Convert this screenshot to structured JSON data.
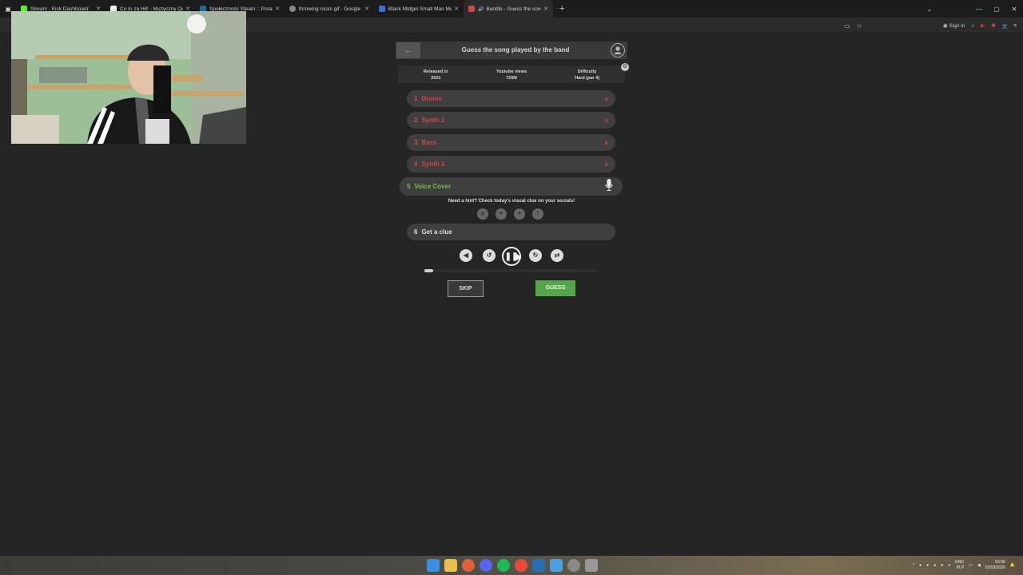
{
  "browser": {
    "tabs": [
      {
        "title": "Stream - Kick Dashboard",
        "color": "#53fc18"
      },
      {
        "title": "Co to za Hit! - Muzyczny Quiz Hip-H",
        "color": "#ffffff"
      },
      {
        "title": "Społeczność Steam :: Poradnik",
        "color": "#1b6aa5"
      },
      {
        "title": "throwing rocks gif - Google Search",
        "color": "#888888"
      },
      {
        "title": "Black Midget Small Man Meme",
        "color": "#3b6fd6"
      },
      {
        "title": "Bandle - Guess the song, one",
        "color": "#d04848",
        "active": true
      }
    ],
    "new_tab": "+",
    "sign_in": "Sign in"
  },
  "header": {
    "back": "←",
    "title": "Guess the song played by the band"
  },
  "info": {
    "released_label": "Released in",
    "released_value": "2021",
    "views_label": "Youtube views",
    "views_value": "725M",
    "difficulty_label": "Difficulty",
    "difficulty_value": "Hard (par 4)"
  },
  "stems": [
    {
      "num": "1",
      "label": "Drums",
      "status": "failed"
    },
    {
      "num": "2",
      "label": "Synth 1",
      "status": "failed"
    },
    {
      "num": "3",
      "label": "Bass",
      "status": "failed"
    },
    {
      "num": "4",
      "label": "Synth 2",
      "status": "failed"
    },
    {
      "num": "5",
      "label": "Voice Cover",
      "status": "active"
    }
  ],
  "fail_mark": "x",
  "hint": "Need a hint? Check today's visual clue on your socials!",
  "clue": {
    "num": "6",
    "label": "Get a clue"
  },
  "player": {
    "progress": 0.05
  },
  "buttons": {
    "skip": "SKIP",
    "guess": "GUESS"
  },
  "tray": {
    "lang_top": "ENG",
    "lang_bottom": "PLP",
    "time": "03:00",
    "date": "02/03/2026"
  },
  "colors": {
    "fail": "#d0454c",
    "active": "#6fbf4f",
    "guess": "#55a64a"
  }
}
